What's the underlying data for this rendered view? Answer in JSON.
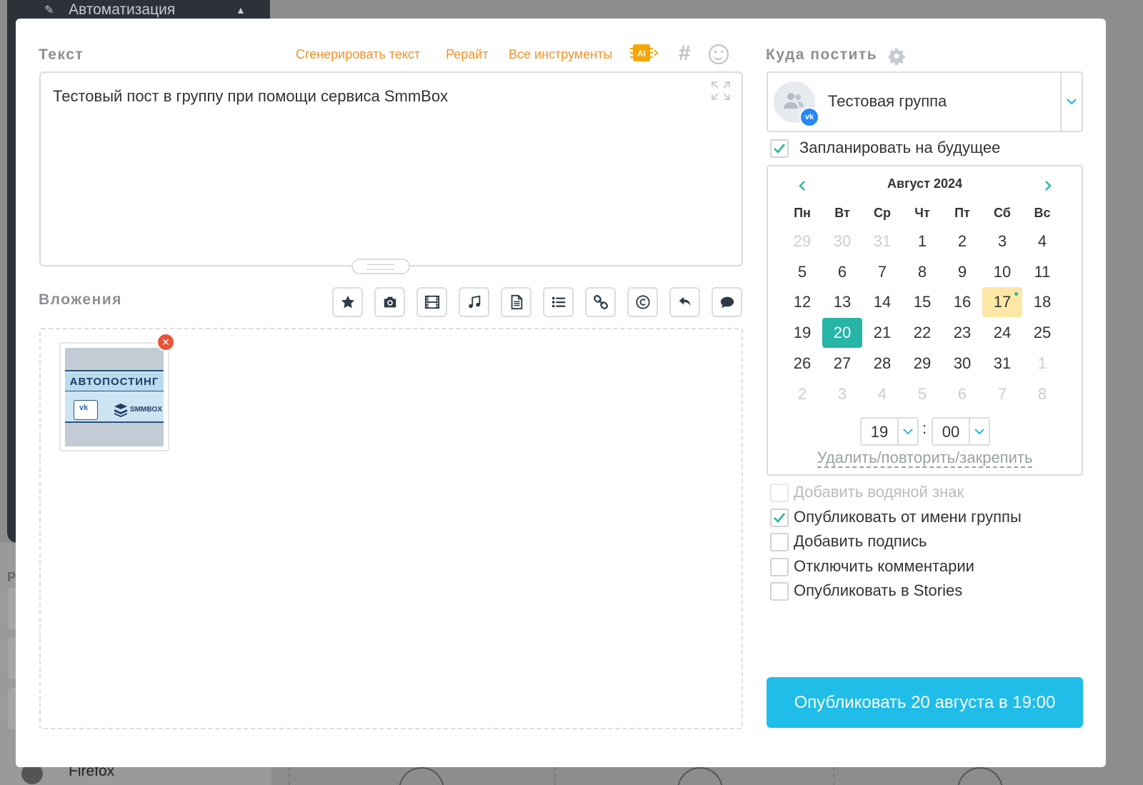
{
  "background": {
    "sidebar_item": "Автоматизация",
    "partial_letter": "P",
    "browser_item": "Firefox"
  },
  "text_section": {
    "label": "Текст",
    "tools": {
      "generate": "Сгенерировать текст",
      "rewrite": "Рерайт",
      "all_tools": "Все инструменты",
      "ai_badge": "AI",
      "hashtag": "#"
    },
    "content": "Тестовый пост в группу при помощи сервиса SmmBox"
  },
  "attachments": {
    "label": "Вложения",
    "buttons": [
      "star-icon",
      "camera-icon",
      "film-icon",
      "music-icon",
      "document-icon",
      "list-icon",
      "link-icon",
      "copyright-icon",
      "reply-icon",
      "comment-icon"
    ],
    "items": [
      {
        "title": "АВТОПОСТИНГ",
        "brand": "SMMBOX"
      }
    ]
  },
  "destination": {
    "label": "Куда постить",
    "group_name": "Тестовая группа",
    "network_badge": "vk"
  },
  "schedule": {
    "label": "Запланировать на будущее",
    "checked": true,
    "month_title": "Август 2024",
    "weekdays": [
      "Пн",
      "Вт",
      "Ср",
      "Чт",
      "Пт",
      "Сб",
      "Вс"
    ],
    "weeks": [
      [
        "29",
        "30",
        "31",
        "1",
        "2",
        "3",
        "4"
      ],
      [
        "5",
        "6",
        "7",
        "8",
        "9",
        "10",
        "11"
      ],
      [
        "12",
        "13",
        "14",
        "15",
        "16",
        "17",
        "18"
      ],
      [
        "19",
        "20",
        "21",
        "22",
        "23",
        "24",
        "25"
      ],
      [
        "26",
        "27",
        "28",
        "29",
        "30",
        "31",
        "1"
      ],
      [
        "2",
        "3",
        "4",
        "5",
        "6",
        "7",
        "8"
      ]
    ],
    "today": "17",
    "selected": "20",
    "hour": "19",
    "minute": "00",
    "time_separator": ":",
    "repeat_link": "Удалить/повторить/закрепить"
  },
  "options": [
    {
      "label": "Добавить водяной знак",
      "checked": false,
      "disabled": true
    },
    {
      "label": "Опубликовать от имени группы",
      "checked": true,
      "disabled": false
    },
    {
      "label": "Добавить подпись",
      "checked": false,
      "disabled": false
    },
    {
      "label": "Отключить комментарии",
      "checked": false,
      "disabled": false
    },
    {
      "label": "Опубликовать в Stories",
      "checked": false,
      "disabled": false
    }
  ],
  "publish_button": "Опубликовать 20 августа в 19:00",
  "colors": {
    "accent": "#1fbde8",
    "link_orange": "#f0932b",
    "selected_day": "#26b5a6",
    "today_day": "#fce7a4",
    "check_teal": "#2bb3a3"
  }
}
